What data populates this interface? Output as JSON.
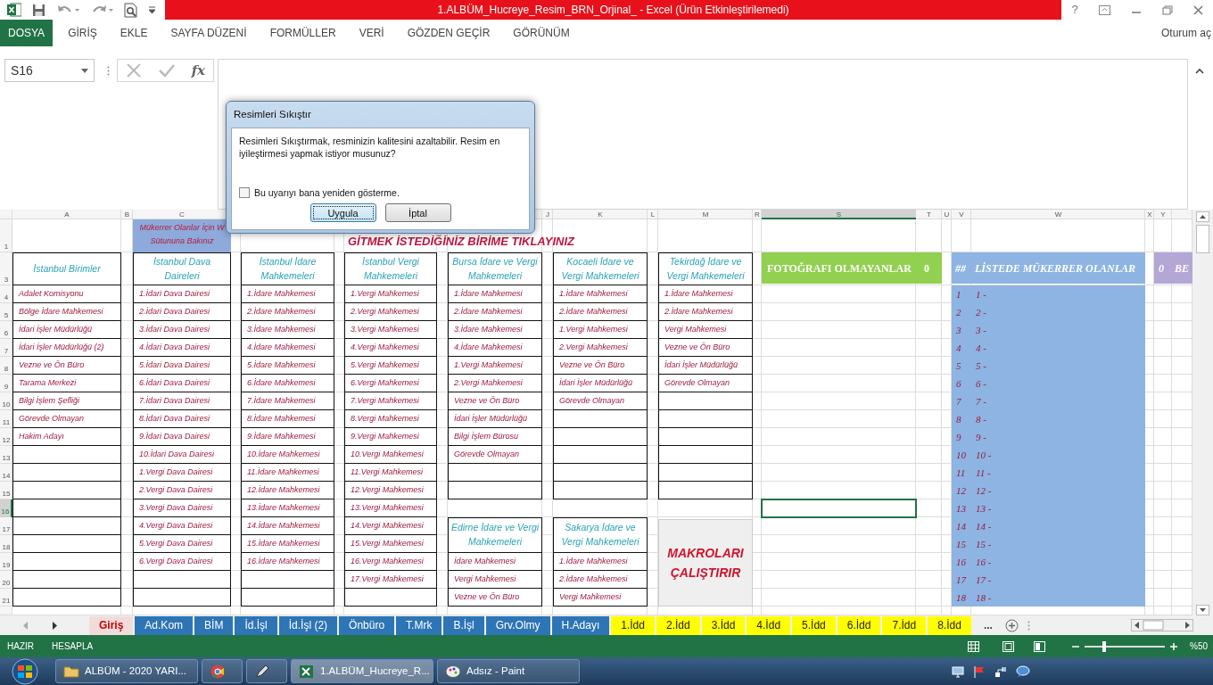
{
  "title_bar": {
    "title": "1.ALBÜM_Hucreye_Resim_BRN_Orjinal_ - Excel (Ürün Etkinleştirilemedi)",
    "help": "?"
  },
  "ribbon_tabs": [
    {
      "label": "DOSYA",
      "selected": true
    },
    {
      "label": "GİRİŞ",
      "selected": false
    },
    {
      "label": "EKLE",
      "selected": false
    },
    {
      "label": "SAYFA DÜZENİ",
      "selected": false
    },
    {
      "label": "FORMÜLLER",
      "selected": false
    },
    {
      "label": "VERİ",
      "selected": false
    },
    {
      "label": "GÖZDEN GEÇİR",
      "selected": false
    },
    {
      "label": "GÖRÜNÜM",
      "selected": false
    }
  ],
  "account": "Oturum aç",
  "formula_bar": {
    "name_box": "S16",
    "fx": "fx"
  },
  "column_headers": [
    {
      "letter": "A",
      "selected": false
    },
    {
      "letter": "B",
      "selected": false
    },
    {
      "letter": "C",
      "selected": false
    },
    {
      "letter": "J",
      "selected": false
    },
    {
      "letter": "K",
      "selected": false
    },
    {
      "letter": "L",
      "selected": false
    },
    {
      "letter": "M",
      "selected": false
    },
    {
      "letter": "R",
      "selected": false
    },
    {
      "letter": "S",
      "selected": true
    },
    {
      "letter": "T",
      "selected": false
    },
    {
      "letter": "U",
      "selected": false
    },
    {
      "letter": "V",
      "selected": false
    },
    {
      "letter": "W",
      "selected": false
    },
    {
      "letter": "X",
      "selected": false
    },
    {
      "letter": "Y",
      "selected": false
    }
  ],
  "row_headers": [
    {
      "label": "1",
      "selected": false
    },
    {
      "label": "3",
      "selected": false
    },
    {
      "label": "4",
      "selected": false
    },
    {
      "label": "5",
      "selected": false
    },
    {
      "label": "6",
      "selected": false
    },
    {
      "label": "7",
      "selected": false
    },
    {
      "label": "8",
      "selected": false
    },
    {
      "label": "9",
      "selected": false
    },
    {
      "label": "10",
      "selected": false
    },
    {
      "label": "11",
      "selected": false
    },
    {
      "label": "12",
      "selected": false
    },
    {
      "label": "13",
      "selected": false
    },
    {
      "label": "14",
      "selected": false
    },
    {
      "label": "15",
      "selected": false
    },
    {
      "label": "16",
      "selected": true
    },
    {
      "label": "17",
      "selected": false
    },
    {
      "label": "18",
      "selected": false
    },
    {
      "label": "19",
      "selected": false
    },
    {
      "label": "20",
      "selected": false
    },
    {
      "label": "21",
      "selected": false
    }
  ],
  "note": "Mükerrer Olanlar İçin W Sütununa Bakınız",
  "banner": "GİTMEK İSTEDİĞİNİZ BİRİME TIKLAYINIZ",
  "unit_lists": [
    {
      "title": "İstanbul Birimler",
      "items": [
        "Adalet Komisyonu",
        "Bölge İdare Mahkemesi",
        "İdari İşler Müdürlüğü",
        "İdari İşler Müdürlüğü (2)",
        "Vezne ve Ön Büro",
        "Tarama Merkezi",
        "Bilgi İşlem Şefliği",
        "Görevde Olmayan",
        "Hakim Adayı"
      ]
    },
    {
      "title": "İstanbul Dava Daireleri",
      "items": [
        "1.İdari Dava Dairesi",
        "2.İdari Dava Dairesi",
        "3.İdari Dava Dairesi",
        "4.İdari Dava Dairesi",
        "5.İdari Dava Dairesi",
        "6.İdari Dava Dairesi",
        "7.İdari Dava Dairesi",
        "8.İdari Dava Dairesi",
        "9.İdari Dava Dairesi",
        "10.İdari Dava Dairesi",
        "1.Vergi Dava Dairesi",
        "2.Vergi Dava Dairesi",
        "3.Vergi Dava Dairesi",
        "4.Vergi Dava Dairesi",
        "5.Vergi Dava Dairesi",
        "6.Vergi Dava Dairesi"
      ]
    },
    {
      "title": "İstanbul İdare Mahkemeleri",
      "items": [
        "1.İdare Mahkemesi",
        "2.İdare Mahkemesi",
        "3.İdare Mahkemesi",
        "4.İdare Mahkemesi",
        "5.İdare Mahkemesi",
        "6.İdare Mahkemesi",
        "7.İdare Mahkemesi",
        "8.İdare Mahkemesi",
        "9.İdare Mahkemesi",
        "10.İdare Mahkemesi",
        "11.İdare Mahkemesi",
        "12.İdare Mahkemesi",
        "13.İdare Mahkemesi",
        "14.İdare Mahkemesi",
        "15.İdare Mahkemesi",
        "16.İdare Mahkemesi"
      ]
    },
    {
      "title": "İstanbul Vergi Mahkemeleri",
      "items": [
        "1.Vergi Mahkemesi",
        "2.Vergi Mahkemesi",
        "3.Vergi Mahkemesi",
        "4.Vergi Mahkemesi",
        "5.Vergi Mahkemesi",
        "6.Vergi Mahkemesi",
        "7.Vergi Mahkemesi",
        "8.Vergi Mahkemesi",
        "9.Vergi Mahkemesi",
        "10.Vergi Mahkemesi",
        "11.Vergi Mahkemesi",
        "12.Vergi Mahkemesi",
        "13.Vergi Mahkemesi",
        "14.Vergi Mahkemesi",
        "15.Vergi Mahkemesi",
        "16.Vergi Mahkemesi",
        "17.Vergi Mahkemesi"
      ]
    },
    {
      "title": "Bursa İdare ve Vergi Mahkemeleri",
      "items": [
        "1.İdare Mahkemesi",
        "2.İdare Mahkemesi",
        "3.İdare Mahkemesi",
        "4.İdare Mahkemesi",
        "1.Vergi Mahkemesi",
        "2.Vergi Mahkemesi",
        "Vezne ve Ön Büro",
        "İdari İşler Müdürlüğü",
        "Bilgi İşlem Bürosu",
        "Görevde Olmayan"
      ]
    },
    {
      "title": "Kocaeli İdare ve Vergi Mahkemeleri",
      "items": [
        "1.İdare Mahkemesi",
        "2.İdare Mahkemesi",
        "1.Vergi Mahkemesi",
        "2.Vergi Mahkemesi",
        "Vezne ve Ön Büro",
        "İdari İşler Müdürlüğü",
        "Görevde Olmayan"
      ]
    },
    {
      "title": "Tekirdağ İdare ve Vergi Mahkemeleri",
      "items": [
        "1.İdare Mahkemesi",
        "2.İdare Mahkemesi",
        "Vergi Mahkemesi",
        "Vezne ve Ön Büro",
        "İdari İşler Müdürlüğü",
        "Görevde Olmayan"
      ]
    },
    {
      "title": "Edirne İdare ve Vergi Mahkemeleri",
      "items": [
        "İdare Mahkemesi",
        "Vergi Mahkemesi",
        "Vezne ve Ön Büro"
      ]
    },
    {
      "title": "Sakarya İdare ve Vergi Mahkemeleri",
      "items": [
        "1.İdare Mahkemesi",
        "2.İdare Mahkemesi",
        "Vergi Mahkemesi"
      ]
    }
  ],
  "macro_button": "MAKROLARI ÇALIŞTIRIR",
  "no_photo": {
    "title": "FOTOĞRAFI OLMAYANLAR",
    "count": "0"
  },
  "duplicates": {
    "index_heading": "##",
    "title": "LİSTEDE MÜKERRER OLANLAR",
    "rows": [
      {
        "number": "1",
        "entry": "1 -"
      },
      {
        "number": "2",
        "entry": "2 -"
      },
      {
        "number": "3",
        "entry": "3 -"
      },
      {
        "number": "4",
        "entry": "4 -"
      },
      {
        "number": "5",
        "entry": "5 -"
      },
      {
        "number": "6",
        "entry": "6 -"
      },
      {
        "number": "7",
        "entry": "7 -"
      },
      {
        "number": "8",
        "entry": "8 -"
      },
      {
        "number": "9",
        "entry": "9 -"
      },
      {
        "number": "10",
        "entry": "10 -"
      },
      {
        "number": "11",
        "entry": "11 -"
      },
      {
        "number": "12",
        "entry": "12 -"
      },
      {
        "number": "13",
        "entry": "13 -"
      },
      {
        "number": "14",
        "entry": "14 -"
      },
      {
        "number": "15",
        "entry": "15 -"
      },
      {
        "number": "16",
        "entry": "16 -"
      },
      {
        "number": "17",
        "entry": "17 -"
      },
      {
        "number": "18",
        "entry": "18 -"
      }
    ]
  },
  "third_header": {
    "count": "0",
    "title": "BE"
  },
  "sheet_tabs": [
    {
      "label": "Giriş",
      "selected": true,
      "color": "#f2dcdb"
    },
    {
      "label": "Ad.Kom",
      "selected": false,
      "color": "#2e75b6"
    },
    {
      "label": "BİM",
      "selected": false,
      "color": "#2e75b6"
    },
    {
      "label": "İd.İşl",
      "selected": false,
      "color": "#2e75b6"
    },
    {
      "label": "İd.İşl (2)",
      "selected": false,
      "color": "#2e75b6"
    },
    {
      "label": "Önbüro",
      "selected": false,
      "color": "#2e75b6"
    },
    {
      "label": "T.Mrk",
      "selected": false,
      "color": "#2e75b6"
    },
    {
      "label": "B.İşl",
      "selected": false,
      "color": "#2e75b6"
    },
    {
      "label": "Grv.Olmy",
      "selected": false,
      "color": "#2e75b6"
    },
    {
      "label": "H.Adayı",
      "selected": false,
      "color": "#2e75b6"
    },
    {
      "label": "1.İdd",
      "selected": false,
      "color": "#ffff00"
    },
    {
      "label": "2.İdd",
      "selected": false,
      "color": "#ffff00"
    },
    {
      "label": "3.İdd",
      "selected": false,
      "color": "#ffff00"
    },
    {
      "label": "4.İdd",
      "selected": false,
      "color": "#ffff00"
    },
    {
      "label": "5.İdd",
      "selected": false,
      "color": "#ffff00"
    },
    {
      "label": "6.İdd",
      "selected": false,
      "color": "#ffff00"
    },
    {
      "label": "7.İdd",
      "selected": false,
      "color": "#ffff00"
    },
    {
      "label": "8.İdd",
      "selected": false,
      "color": "#ffff00"
    }
  ],
  "more_tabs": "...",
  "status_bar": {
    "mode": "HAZIR",
    "calc": "HESAPLA",
    "zoom": "%50",
    "zoom_slider": {
      "level": 0.25
    }
  },
  "dialog": {
    "title": "Resimleri Sıkıştır",
    "message": "Resimleri Sıkıştırmak, resminizin kalitesini azaltabilir. Resim en iyileştirmesi yapmak istiyor musunuz?",
    "checkbox": {
      "label": "Bu uyarıyı bana yeniden gösterme.",
      "checked": false
    },
    "buttons": [
      {
        "label": "Uygula",
        "default": true
      },
      {
        "label": "İptal",
        "default": false
      }
    ]
  },
  "taskbar": {
    "tasks": [
      {
        "kind": "folder",
        "label": "ALBÜM - 2020 YARI...",
        "selected": false
      },
      {
        "kind": "browser",
        "selected": false
      },
      {
        "kind": "pen",
        "selected": false
      },
      {
        "kind": "excel",
        "label": "1.ALBÜM_Hucreye_R...",
        "selected": true
      },
      {
        "kind": "paint",
        "label": "Adsız - Paint",
        "selected": false
      }
    ]
  }
}
